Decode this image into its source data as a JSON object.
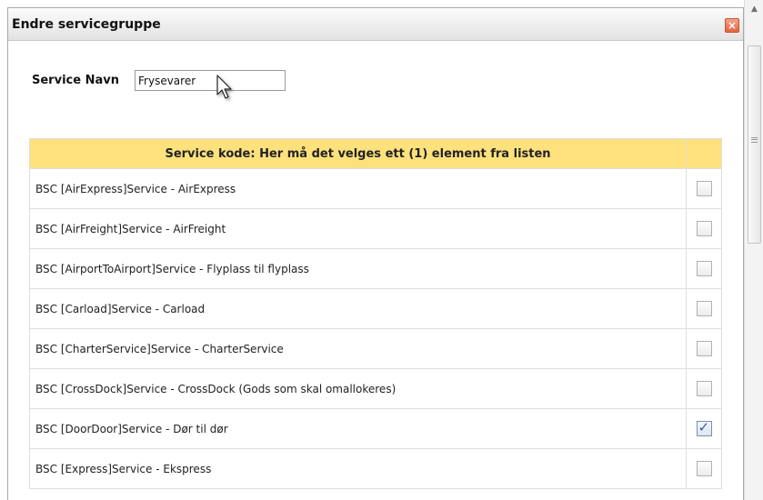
{
  "dialog": {
    "title": "Endre servicegruppe",
    "close_icon": "close-icon"
  },
  "form": {
    "name_label": "Service Navn",
    "name_value": "Frysevarer"
  },
  "service_table": {
    "header": "Service kode: Her må det velges ett (1) element fra listen",
    "rows": [
      {
        "label": "BSC [AirExpress]Service - AirExpress",
        "checked": false
      },
      {
        "label": "BSC [AirFreight]Service - AirFreight",
        "checked": false
      },
      {
        "label": "BSC [AirportToAirport]Service - Flyplass til flyplass",
        "checked": false
      },
      {
        "label": "BSC [Carload]Service - Carload",
        "checked": false
      },
      {
        "label": "BSC [CharterService]Service - CharterService",
        "checked": false
      },
      {
        "label": "BSC [CrossDock]Service - CrossDock (Gods som skal omallokeres)",
        "checked": false
      },
      {
        "label": "BSC [DoorDoor]Service - Dør til dør",
        "checked": true
      },
      {
        "label": "BSC [Express]Service - Ekspress",
        "checked": false
      }
    ]
  },
  "colors": {
    "header_bg": "#fde17d",
    "close_button": "#e2643f",
    "checkmark": "#3f5f98"
  }
}
